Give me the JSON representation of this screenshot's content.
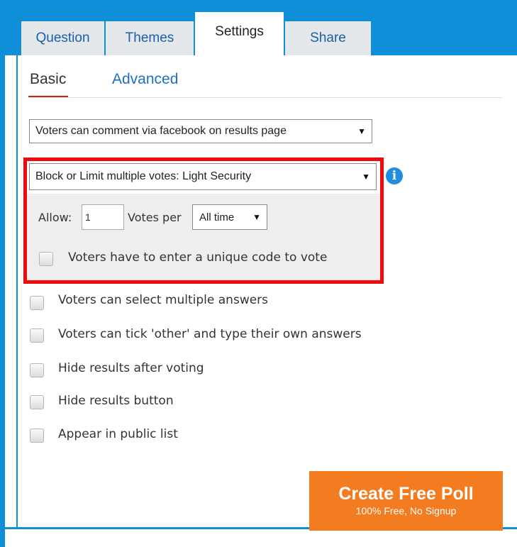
{
  "tabs": [
    {
      "label": "Question"
    },
    {
      "label": "Themes"
    },
    {
      "label": "Settings"
    },
    {
      "label": "Share"
    }
  ],
  "subtabs": {
    "basic": "Basic",
    "advanced": "Advanced"
  },
  "comments_select": {
    "value": "Voters can comment via facebook on results page"
  },
  "security_select": {
    "value": "Block or Limit multiple votes: Light Security"
  },
  "allow": {
    "label": "Allow:",
    "value": "1",
    "votes_per_label": "Votes per",
    "period": "All time"
  },
  "unique_code": {
    "label": "Voters have to enter a unique code to vote"
  },
  "options": [
    {
      "label": "Voters can select multiple answers"
    },
    {
      "label": "Voters can tick 'other' and type their own answers"
    },
    {
      "label": "Hide results after voting"
    },
    {
      "label": "Hide results button"
    },
    {
      "label": "Appear in public list"
    }
  ],
  "create_button": {
    "title": "Create Free Poll",
    "subtitle": "100% Free, No Signup"
  },
  "colors": {
    "accent_blue": "#0e8fd8",
    "highlight_red": "#ee0a0a",
    "cta_orange": "#f47c20"
  }
}
